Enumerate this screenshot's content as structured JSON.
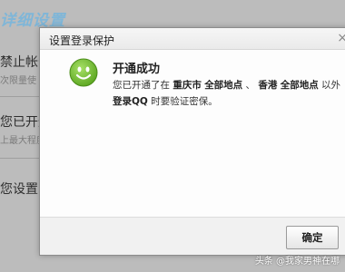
{
  "background_page": {
    "title": "详细设置",
    "rows": [
      {
        "main": "禁止帐号",
        "sub": "次限量使"
      },
      {
        "main": "您已开通了",
        "sub": "上最大程度"
      },
      {
        "main": "您设置了"
      }
    ]
  },
  "dialog": {
    "title": "设置登录保护",
    "close_icon": "close-icon",
    "status_icon": "smiley-face-icon",
    "success_title": "开通成功",
    "message": {
      "prefix": "您已开通了在 ",
      "city1": "重庆市",
      "space1": " ",
      "scope1": "全部地点",
      "sep": " 、 ",
      "city2": "香港",
      "space2": " ",
      "scope2": "全部地点",
      "mid": " 以外 ",
      "login_qq": "登录QQ",
      "suffix": " 时要验证密保。"
    },
    "ok_label": "确定"
  },
  "watermark": "头条 @我家男神在哪",
  "colors": {
    "accent_title": "#7fb6d8",
    "smiley_green": "#6cb52b"
  }
}
